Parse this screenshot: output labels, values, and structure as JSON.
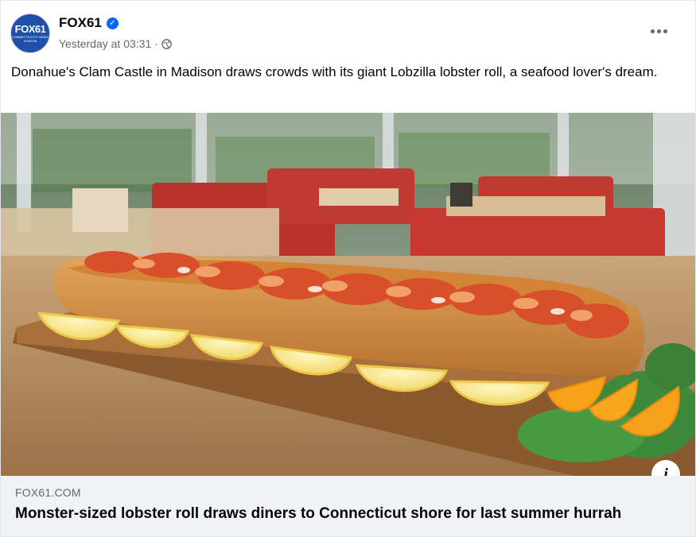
{
  "post": {
    "page_name": "FOX61",
    "timestamp": "Yesterday at 03:31",
    "separator": "·",
    "privacy_icon": "globe-icon",
    "verified_icon": "verified-badge-icon",
    "more_icon": "more-options-icon",
    "caption": "Donahue's Clam Castle in Madison draws crowds with its giant Lobzilla lobster roll, a  seafood lover's dream."
  },
  "avatar": {
    "logo_main": "FOX61",
    "logo_sub": "CONNECTICUT'S NEWS STATION"
  },
  "link": {
    "domain": "FOX61.COM",
    "headline": "Monster-sized lobster roll draws diners to Connecticut shore for last summer hurrah",
    "info_label": "i"
  },
  "colors": {
    "brand_blue": "#1f4fa8",
    "verified_blue": "#0866ff",
    "meta_gray": "#65676b",
    "link_bg": "#f0f2f5"
  }
}
